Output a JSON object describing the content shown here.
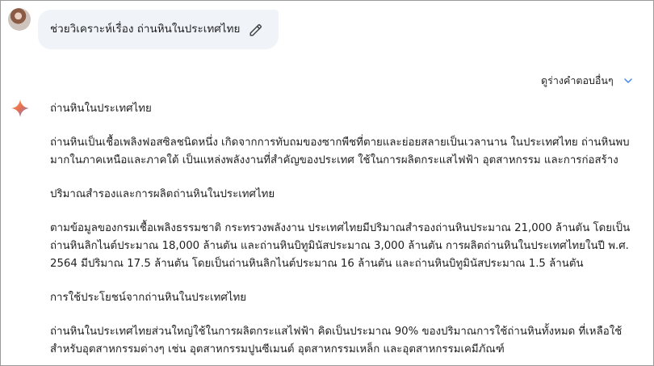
{
  "prompt": {
    "text": "ช่วยวิเคราะห์เรื่อง ถ่านหินในประเทศไทย"
  },
  "drafts": {
    "label": "ดูร่างคำตอบอื่นๆ"
  },
  "response": {
    "title": "ถ่านหินในประเทศไทย",
    "intro": "ถ่านหินเป็นเชื้อเพลิงฟอสซิลชนิดหนึ่ง เกิดจากการทับถมของซากพืชที่ตายและย่อยสลายเป็นเวลานาน ในประเทศไทย ถ่านหินพบมากในภาคเหนือและภาคใต้ เป็นแหล่งพลังงานที่สำคัญของประเทศ ใช้ในการผลิตกระแสไฟฟ้า อุตสาหกรรม และการก่อสร้าง",
    "section1_heading": "ปริมาณสำรองและการผลิตถ่านหินในประเทศไทย",
    "section1_body": "ตามข้อมูลของกรมเชื้อเพลิงธรรมชาติ กระทรวงพลังงาน ประเทศไทยมีปริมาณสำรองถ่านหินประมาณ 21,000 ล้านตัน โดยเป็นถ่านหินลิกไนต์ประมาณ 18,000 ล้านตัน และถ่านหินบิทูมินัสประมาณ 3,000 ล้านตัน การผลิตถ่านหินในประเทศไทยในปี พ.ศ. 2564 มีปริมาณ 17.5 ล้านตัน โดยเป็นถ่านหินลิกไนต์ประมาณ 16 ล้านตัน และถ่านหินบิทูมินัสประมาณ 1.5 ล้านตัน",
    "section2_heading": "การใช้ประโยชน์จากถ่านหินในประเทศไทย",
    "section2_body": "ถ่านหินในประเทศไทยส่วนใหญ่ใช้ในการผลิตกระแสไฟฟ้า คิดเป็นประมาณ 90% ของปริมาณการใช้ถ่านหินทั้งหมด ที่เหลือใช้สำหรับอุตสาหกรรมต่างๆ เช่น อุตสาหกรรมปูนซีเมนต์ อุตสาหกรรมเหล็ก และอุตสาหกรรมเคมีภัณฑ์"
  },
  "colors": {
    "bubble_bg": "#f0f4f9",
    "accent_blue": "#4285f4",
    "text": "#1f1f1f"
  },
  "icons": {
    "edit": "pencil-icon",
    "expand": "chevron-down-icon",
    "assistant": "sparkle-icon",
    "user": "avatar"
  }
}
